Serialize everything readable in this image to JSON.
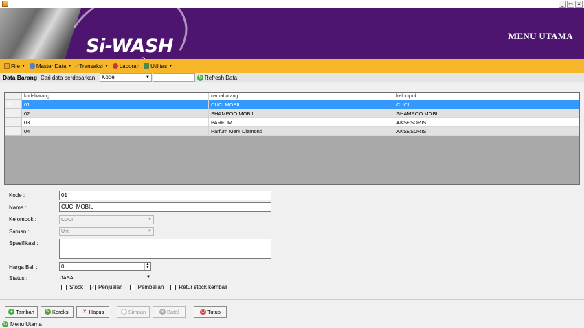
{
  "window": {
    "min_glyph": "_",
    "restore_glyph": "▭",
    "close_glyph": "✕"
  },
  "banner": {
    "logo": "Si-WASH",
    "logo_sub": "software",
    "title": "MENU UTAMA"
  },
  "menu": [
    {
      "label": "File",
      "icon": "folder-icon"
    },
    {
      "label": "Master Data",
      "icon": "database-icon"
    },
    {
      "label": "Transaksi",
      "icon": "pencil-icon"
    },
    {
      "label": "Laporan",
      "icon": "report-icon"
    },
    {
      "label": "Utilitas",
      "icon": "tools-icon"
    }
  ],
  "toolbar": {
    "title": "Data Barang",
    "search_label": "Cari data berdasarkan",
    "search_field": "Kode",
    "search_value": "",
    "refresh_label": "Refresh Data"
  },
  "grid": {
    "columns": [
      "kodebarang",
      "namabarang",
      "kelompok"
    ],
    "rows": [
      {
        "kode": "01",
        "nama": "CUCI MOBIL",
        "kelompok": "CUCI",
        "selected": true
      },
      {
        "kode": "02",
        "nama": "SHAMPOO MOBIL",
        "kelompok": "SHAMPOO MOBIL"
      },
      {
        "kode": "03",
        "nama": "PARFUM",
        "kelompok": "AKSESORIS"
      },
      {
        "kode": "04",
        "nama": "Parfum Merk Diamond",
        "kelompok": "AKSESORIS"
      }
    ]
  },
  "form": {
    "kode_label": "Kode :",
    "kode_value": "01",
    "nama_label": "Nama :",
    "nama_value": "CUCI MOBIL",
    "kelompok_label": "Kelompok :",
    "kelompok_value": "CUCI",
    "satuan_label": "Satuan :",
    "satuan_value": "Unit",
    "spesifikasi_label": "Spesifikasi :",
    "spesifikasi_value": "",
    "harga_label": "Harga Beli :",
    "harga_value": "0",
    "status_label": "Status :",
    "status_value": "JASA",
    "checks": [
      {
        "label": "Stock",
        "checked": false
      },
      {
        "label": "Penjualan",
        "checked": true
      },
      {
        "label": "Pembelian",
        "checked": false
      },
      {
        "label": "Retur stock kembali",
        "checked": false
      }
    ]
  },
  "buttons": {
    "tambah": "Tambah",
    "koreksi": "Koreksi",
    "hapus": "Hapus",
    "simpan": "Simpan",
    "batal": "Batal",
    "tutup": "Tutup"
  },
  "statusbar": {
    "label": "Menu Utama"
  },
  "colors": {
    "banner": "#4e1570",
    "menubar": "#f6b62a",
    "selection": "#3399ff"
  }
}
